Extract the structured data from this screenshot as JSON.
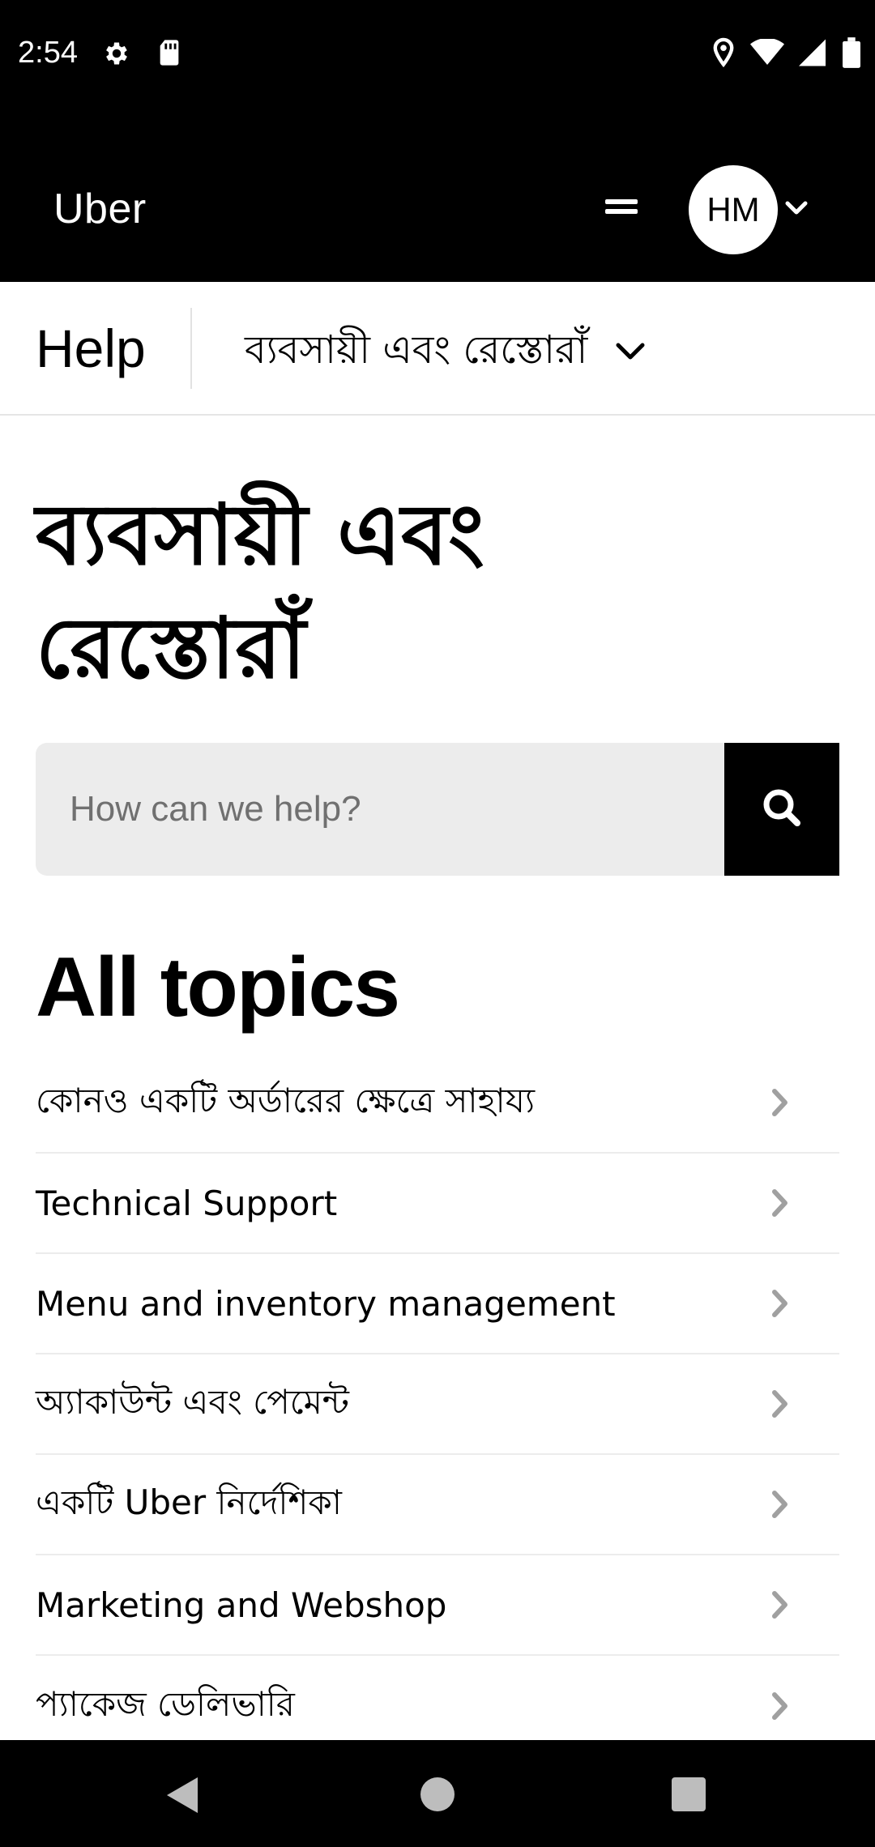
{
  "status_bar": {
    "time": "2:54",
    "left_icons": [
      "gear-icon",
      "sd-card-icon"
    ],
    "right_icons": [
      "location-icon",
      "wifi-icon",
      "signal-icon",
      "battery-icon"
    ]
  },
  "header": {
    "brand": "Uber",
    "menu_icon": "hamburger-icon",
    "avatar_initials": "HM",
    "avatar_chevron": "chevron-down-icon"
  },
  "help_bar": {
    "title": "Help",
    "dropdown_label": "ব্যবসায়ী এবং রেস্তোরাঁ"
  },
  "page": {
    "title": "ব্যবসায়ী এবং রেস্তোরাঁ"
  },
  "search": {
    "placeholder": "How can we help?",
    "value": "",
    "button_icon": "search-icon"
  },
  "topics": {
    "heading": "All topics",
    "items": [
      {
        "label": "কোনও একটি অর্ডারের ক্ষেত্রে সাহায্য"
      },
      {
        "label": "Technical Support"
      },
      {
        "label": "Menu and inventory management"
      },
      {
        "label": "অ্যাকাউন্ট এবং পেমেন্ট"
      },
      {
        "label": "একটি Uber নির্দেশিকা"
      },
      {
        "label": "Marketing and Webshop"
      },
      {
        "label": "প্যাকেজ ডেলিভারি"
      }
    ]
  },
  "nav_bar": {
    "buttons": [
      "back-icon",
      "home-icon",
      "recents-icon"
    ]
  },
  "colors": {
    "header_bg": "#000000",
    "search_bg": "#ececec",
    "chevron": "#a0a0a0",
    "divider": "#ececec"
  }
}
